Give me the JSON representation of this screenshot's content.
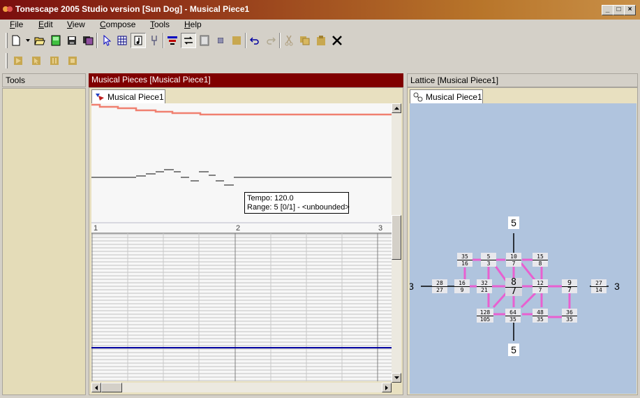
{
  "window": {
    "title": "Tonescape 2005 Studio  version [Sun Dog]  -  Musical Piece1"
  },
  "menu": [
    "File",
    "Edit",
    "View",
    "Compose",
    "Tools",
    "Help"
  ],
  "toolbar": {
    "icons": [
      "new-icon",
      "dropdown-arrow-icon",
      "open-icon",
      "new-piece-icon",
      "save-icon",
      "save-all-icon",
      "pointer-icon",
      "grid-icon",
      "note-icon",
      "tuning-fork-icon",
      "align-icon",
      "loop-icon",
      "page-icon",
      "small-square-icon",
      "square-icon",
      "undo-icon",
      "redo-icon",
      "cut-icon",
      "copy-icon",
      "paste-icon",
      "delete-icon"
    ],
    "transport": [
      "play-icon",
      "pointer-play-icon",
      "pause-icon",
      "stop-icon"
    ]
  },
  "panels": {
    "tools": {
      "title": "Tools"
    },
    "pieces": {
      "title": "Musical Pieces  [Musical Piece1]",
      "tab": "Musical Piece1"
    },
    "lattice": {
      "title": "Lattice  [Musical Piece1]",
      "tab": "Musical Piece1"
    }
  },
  "editor": {
    "tooltip": {
      "tempo": "Tempo: 120.0",
      "range": "Range: 5 [0/1] - <unbounded>"
    },
    "measures": [
      "1",
      "2",
      "3"
    ]
  },
  "lattice": {
    "axis_labels": {
      "top": "5",
      "bottom": "5",
      "left": "3",
      "right": "3"
    },
    "center": {
      "num": "8",
      "den": "7"
    },
    "nodes": [
      {
        "num": "35",
        "den": "16"
      },
      {
        "num": "5",
        "den": "3"
      },
      {
        "num": "10",
        "den": "7"
      },
      {
        "num": "15",
        "den": "8"
      },
      {
        "num": "28",
        "den": "27"
      },
      {
        "num": "16",
        "den": "9"
      },
      {
        "num": "32",
        "den": "21"
      },
      {
        "num": "12",
        "den": "7"
      },
      {
        "num": "9",
        "den": "7"
      },
      {
        "num": "27",
        "den": "14"
      },
      {
        "num": "128",
        "den": "105"
      },
      {
        "num": "64",
        "den": "35"
      },
      {
        "num": "48",
        "den": "35"
      },
      {
        "num": "36",
        "den": "35"
      }
    ]
  },
  "colors": {
    "accent": "#800000",
    "lattice_bg": "#b0c4de",
    "edge": "#e860d0",
    "ruler": "#f08070"
  }
}
